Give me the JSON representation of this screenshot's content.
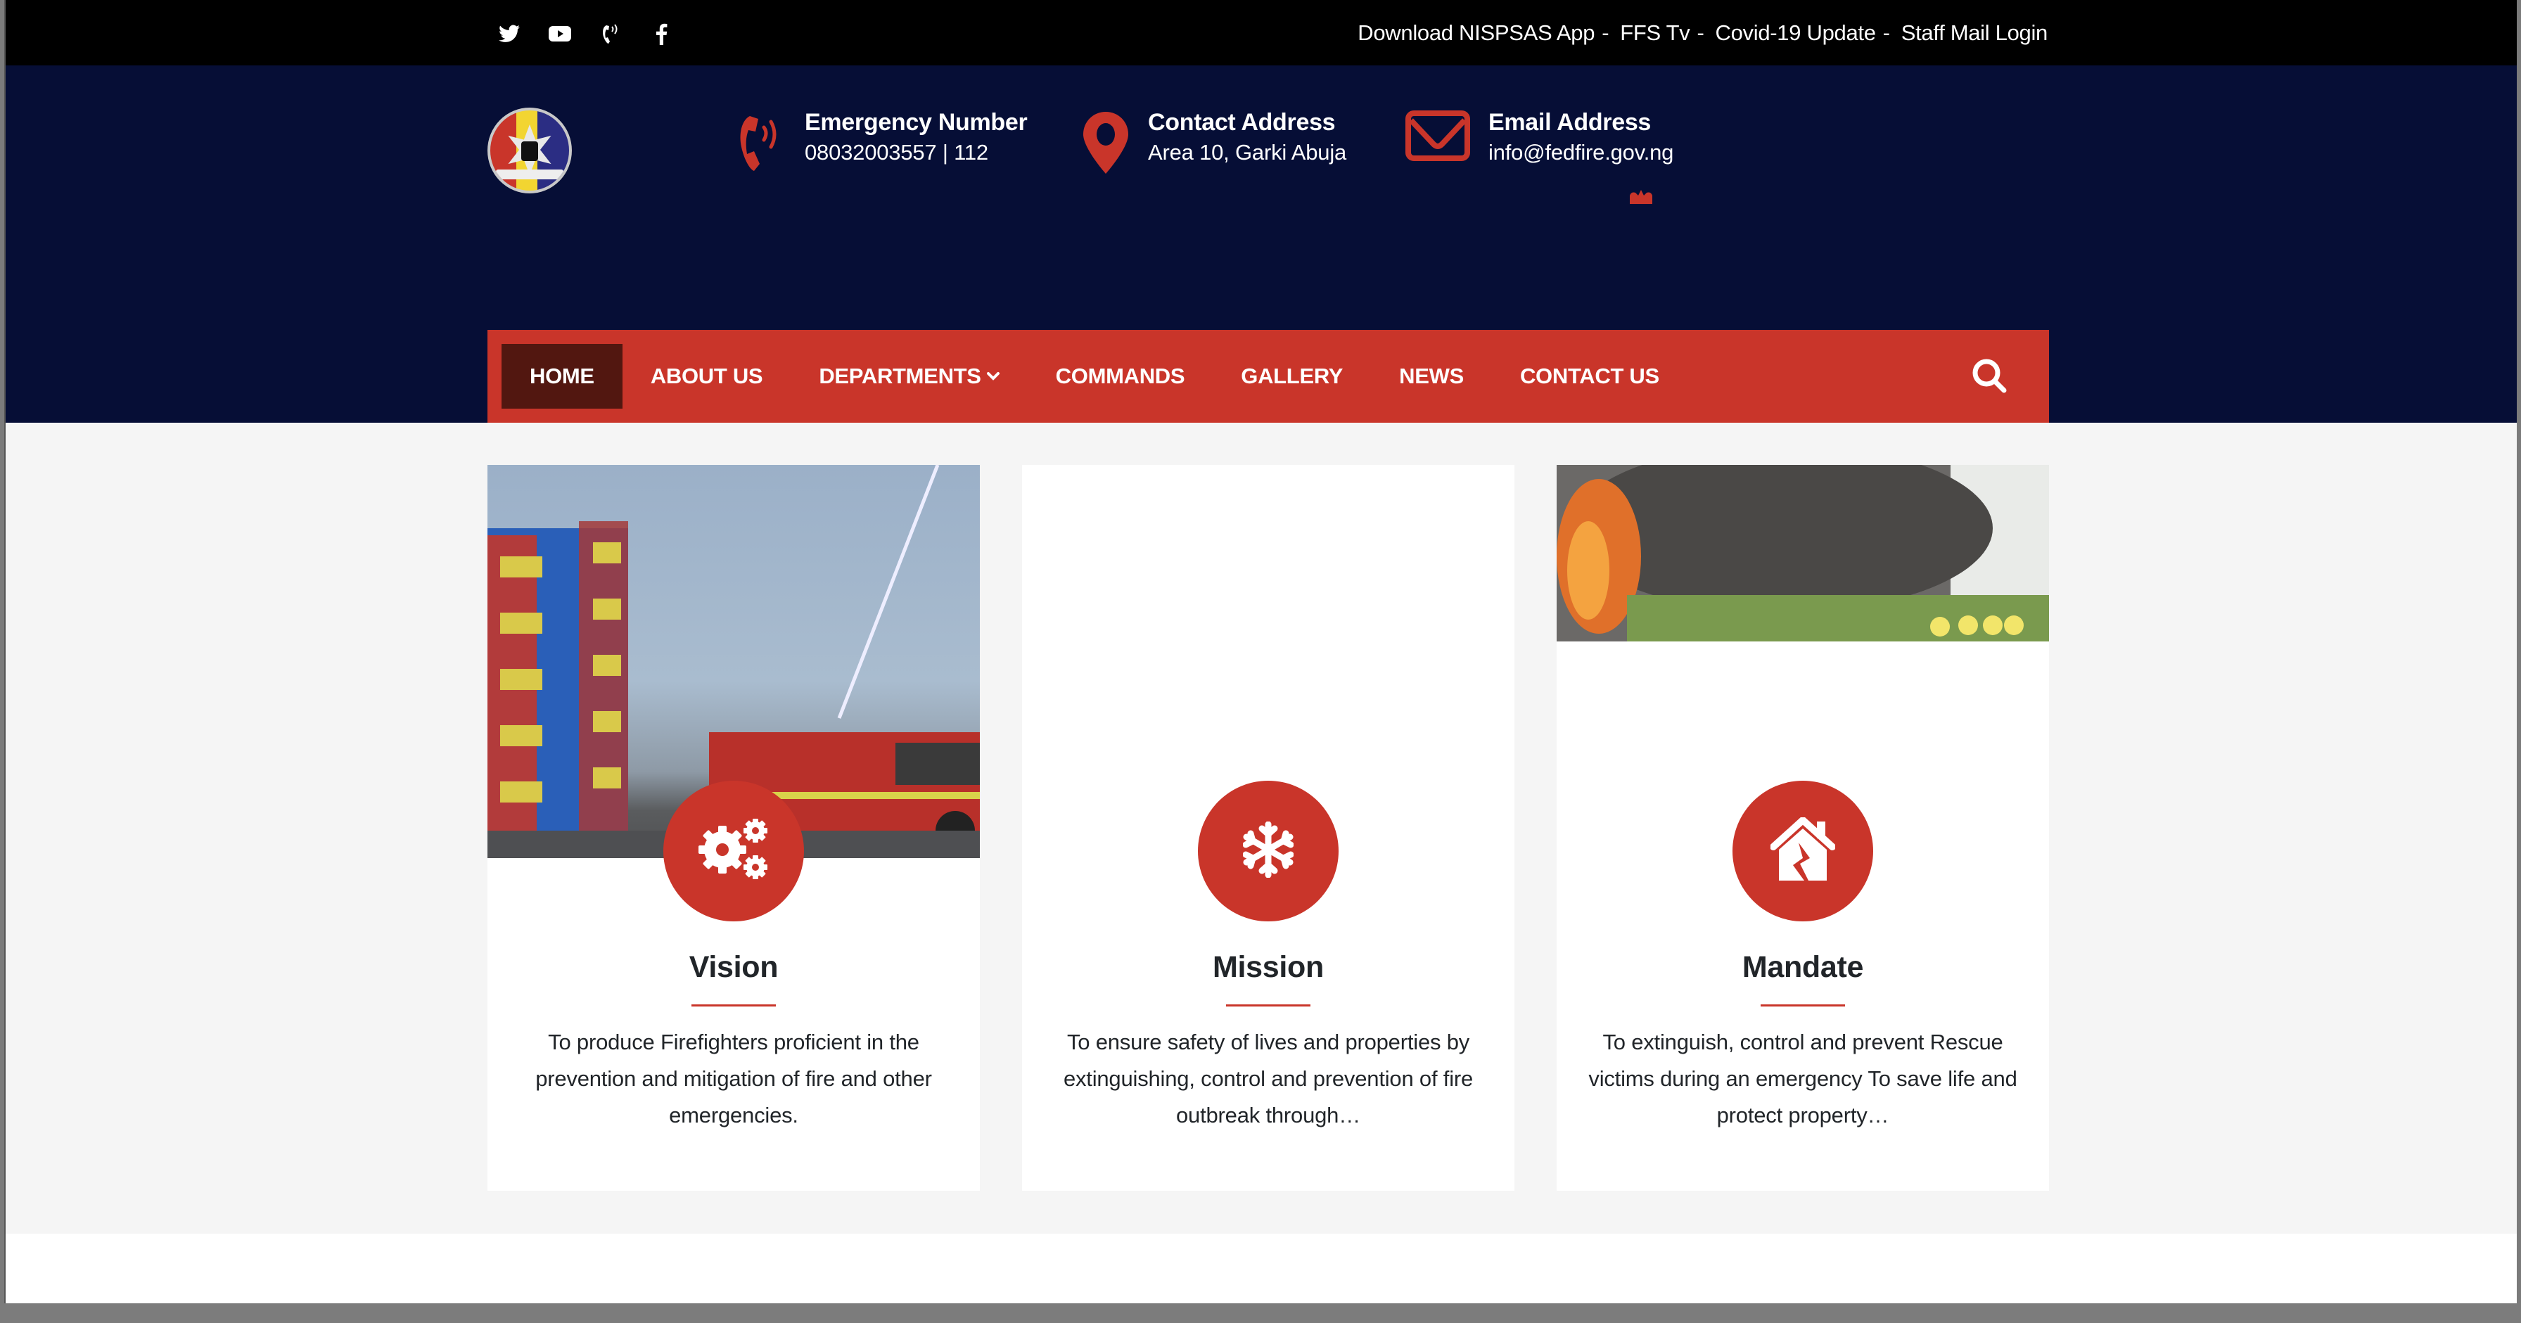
{
  "topbar": {
    "socials": [
      {
        "name": "twitter-icon",
        "label": "Twitter"
      },
      {
        "name": "youtube-icon",
        "label": "YouTube"
      },
      {
        "name": "phone-call-icon",
        "label": "Call"
      },
      {
        "name": "facebook-icon",
        "label": "Facebook"
      }
    ],
    "links": [
      "Download NISPSAS App",
      "FFS Tv",
      "Covid-19 Update",
      "Staff Mail Login"
    ],
    "separator": "-"
  },
  "header": {
    "logo_alt": "Federal Fire Service logo",
    "emergency": {
      "title": "Emergency Number",
      "value": "08032003557 | 112",
      "icon": "phone-ringing-icon"
    },
    "address": {
      "title": "Contact Address",
      "value": "Area 10, Garki Abuja",
      "icon": "map-pin-icon"
    },
    "email": {
      "title": "Email Address",
      "value": "info@fedfire.gov.ng",
      "icon": "envelope-icon"
    }
  },
  "nav": {
    "items": [
      {
        "label": "HOME",
        "active": true
      },
      {
        "label": "ABOUT US",
        "active": false
      },
      {
        "label": "DEPARTMENTS",
        "active": false,
        "dropdown": true
      },
      {
        "label": "COMMANDS",
        "active": false
      },
      {
        "label": "GALLERY",
        "active": false
      },
      {
        "label": "NEWS",
        "active": false
      },
      {
        "label": "CONTACT US",
        "active": false
      }
    ],
    "search_icon": "search-icon"
  },
  "cards": [
    {
      "title": "Vision",
      "icon": "gears-icon",
      "image": "fire-truck-training-tower-photo",
      "text": "To produce Firefighters proficient in the prevention and mitigation of fire and other emergencies."
    },
    {
      "title": "Mission",
      "icon": "snowflake-icon",
      "image": null,
      "text": "To ensure safety of lives and properties by extinguishing, control and prevention of fire outbreak through…"
    },
    {
      "title": "Mandate",
      "icon": "damaged-house-icon",
      "image": "smoke-fire-firefighters-photo",
      "text": "To extinguish, control and prevent Rescue victims during an emergency To save life and protect property…"
    }
  ],
  "colors": {
    "topbar_bg": "#000000",
    "header_bg": "#060E36",
    "accent_red": "#C9352A",
    "nav_active_bg": "#521710",
    "section_bg": "#F5F5F5",
    "text_dark": "#212529"
  }
}
